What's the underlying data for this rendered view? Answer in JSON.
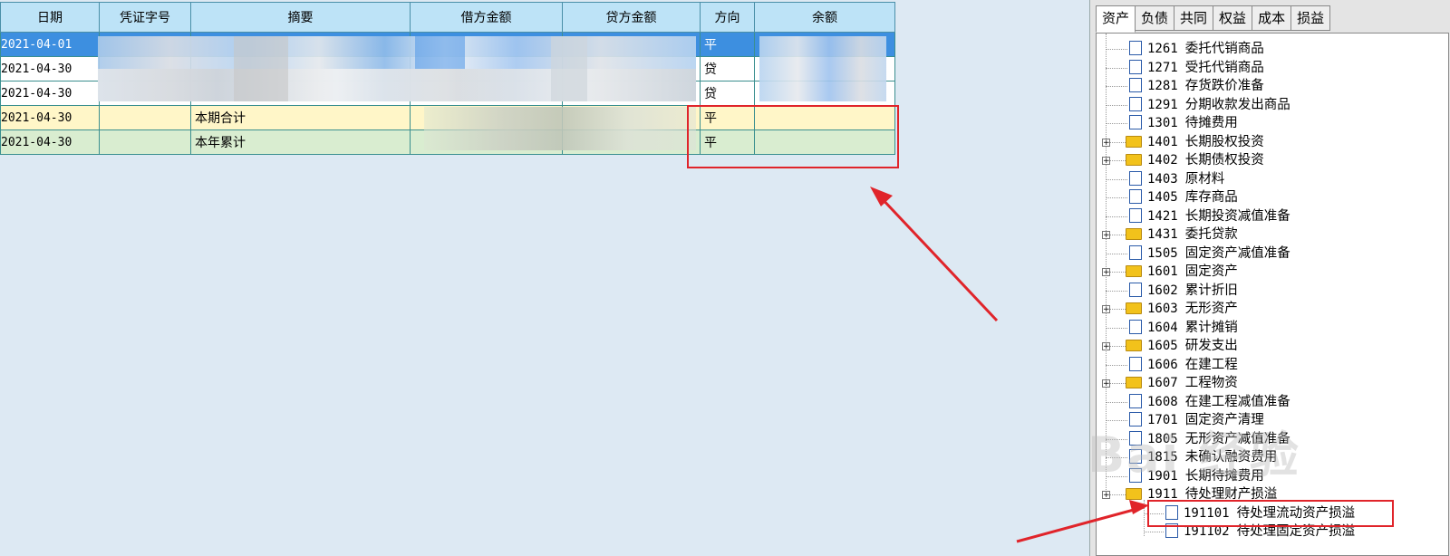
{
  "ledger": {
    "columns": [
      "日期",
      "凭证字号",
      "摘要",
      "借方金额",
      "贷方金额",
      "方向",
      "余额"
    ],
    "rows": [
      {
        "date": "2021-04-01",
        "voucher": "",
        "summary": "",
        "debit": "",
        "credit": "",
        "dir": "平",
        "balance": ""
      },
      {
        "date": "2021-04-30",
        "voucher": "",
        "summary": "",
        "debit": "",
        "credit": "",
        "dir": "贷",
        "balance": ""
      },
      {
        "date": "2021-04-30",
        "voucher": "",
        "summary": "",
        "debit": "",
        "credit": "",
        "dir": "贷",
        "balance": ""
      },
      {
        "date": "2021-04-30",
        "voucher": "",
        "summary": "本期合计",
        "debit": "",
        "credit": "",
        "dir": "平",
        "balance": ""
      },
      {
        "date": "2021-04-30",
        "voucher": "",
        "summary": "本年累计",
        "debit": "",
        "credit": "",
        "dir": "平",
        "balance": ""
      }
    ]
  },
  "tabs": [
    "资产",
    "负债",
    "共同",
    "权益",
    "成本",
    "损益"
  ],
  "tree": [
    {
      "code": "1261",
      "name": "委托代销商品",
      "folder": false
    },
    {
      "code": "1271",
      "name": "受托代销商品",
      "folder": false
    },
    {
      "code": "1281",
      "name": "存货跌价准备",
      "folder": false
    },
    {
      "code": "1291",
      "name": "分期收款发出商品",
      "folder": false
    },
    {
      "code": "1301",
      "name": "待摊费用",
      "folder": false
    },
    {
      "code": "1401",
      "name": "长期股权投资",
      "folder": true
    },
    {
      "code": "1402",
      "name": "长期债权投资",
      "folder": true
    },
    {
      "code": "1403",
      "name": "原材料",
      "folder": false
    },
    {
      "code": "1405",
      "name": "库存商品",
      "folder": false
    },
    {
      "code": "1421",
      "name": "长期投资减值准备",
      "folder": false
    },
    {
      "code": "1431",
      "name": "委托贷款",
      "folder": true
    },
    {
      "code": "1505",
      "name": "固定资产减值准备",
      "folder": false
    },
    {
      "code": "1601",
      "name": "固定资产",
      "folder": true
    },
    {
      "code": "1602",
      "name": "累计折旧",
      "folder": false
    },
    {
      "code": "1603",
      "name": "无形资产",
      "folder": true
    },
    {
      "code": "1604",
      "name": "累计摊销",
      "folder": false
    },
    {
      "code": "1605",
      "name": "研发支出",
      "folder": true
    },
    {
      "code": "1606",
      "name": "在建工程",
      "folder": false
    },
    {
      "code": "1607",
      "name": "工程物资",
      "folder": true
    },
    {
      "code": "1608",
      "name": "在建工程减值准备",
      "folder": false
    },
    {
      "code": "1701",
      "name": "固定资产清理",
      "folder": false
    },
    {
      "code": "1805",
      "name": "无形资产减值准备",
      "folder": false
    },
    {
      "code": "1815",
      "name": "未确认融资费用",
      "folder": false
    },
    {
      "code": "1901",
      "name": "长期待摊费用",
      "folder": false
    },
    {
      "code": "1911",
      "name": "待处理财产损溢",
      "folder": true
    },
    {
      "code": "191101",
      "name": "待处理流动资产损溢",
      "folder": false
    },
    {
      "code": "191102",
      "name": "待处理固定资产损溢",
      "folder": false
    }
  ],
  "watermark": "Bai 经验"
}
